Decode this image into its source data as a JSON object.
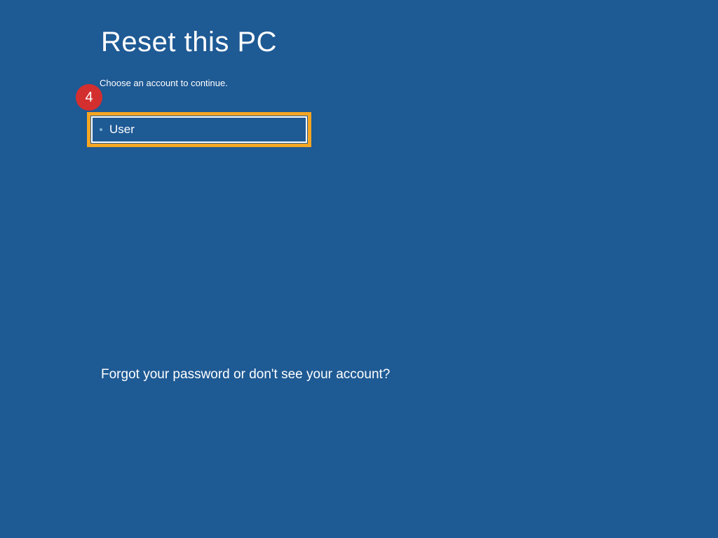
{
  "page": {
    "title": "Reset this PC",
    "subtitle": "Choose an account to continue."
  },
  "accounts": [
    {
      "label": "User"
    }
  ],
  "footer": {
    "forgot_link": "Forgot your password or don't see your account?"
  },
  "annotation": {
    "step_number": "4"
  },
  "colors": {
    "background": "#1e5a94",
    "highlight": "#f5a623",
    "badge": "#d32f2f"
  }
}
